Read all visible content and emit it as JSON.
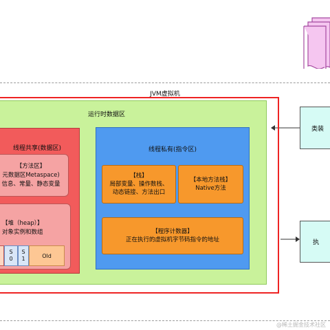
{
  "jvm": {
    "title": "JVM虚拟机"
  },
  "runtime": {
    "title": "运行时数据区"
  },
  "shared": {
    "title": "线程共享(数据区)",
    "method_area": {
      "lines": [
        "【方法区】",
        "元数据区Metaspace)",
        "信息、常量、静态变量"
      ]
    },
    "heap": {
      "lines": [
        "【堆（heap）】",
        "对象实例和数组"
      ],
      "gens": {
        "s0": [
          "S",
          "0"
        ],
        "s1": [
          "S",
          "1"
        ],
        "old": "Old"
      }
    }
  },
  "private": {
    "title": "线程私有(指令区)",
    "stack": {
      "lines": [
        "【栈】",
        "局部变量、操作数栈、",
        "动态链接、方法出口"
      ]
    },
    "native": {
      "lines": [
        "【本地方法栈】",
        "Native方法"
      ]
    },
    "pc": {
      "lines": [
        "【程序计数器】",
        "正在执行的虚拟机字节码指令的地址"
      ]
    }
  },
  "right_boxes": {
    "top": "类装",
    "bottom": "执"
  },
  "watermark": "@稀土掘金技术社区",
  "colors": {
    "jvm_border": "#ee2222",
    "runtime_fill": "#c9f29b",
    "shared_fill": "#f25b5b",
    "private_fill": "#4f9af0",
    "orange_fill": "#f7982c",
    "db_fill": "#f5c6f0",
    "db_stroke": "#a54aa0",
    "side_box_fill": "#d6fbf5"
  }
}
